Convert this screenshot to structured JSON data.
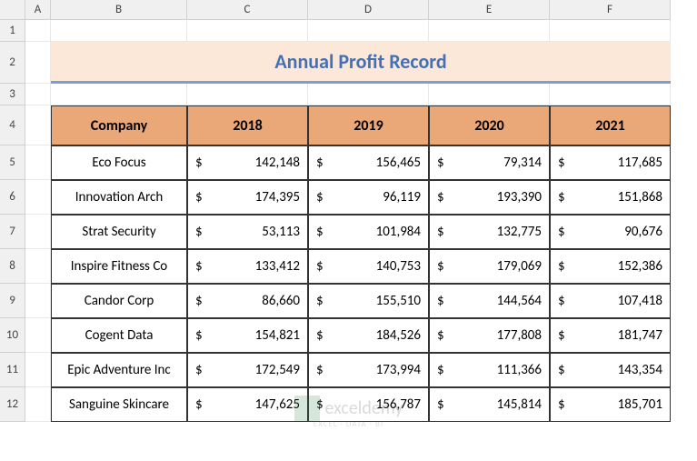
{
  "columns": [
    "A",
    "B",
    "C",
    "D",
    "E",
    "F"
  ],
  "rows": [
    "1",
    "2",
    "3",
    "4",
    "5",
    "6",
    "7",
    "8",
    "9",
    "10",
    "11",
    "12"
  ],
  "title": "Annual Profit Record",
  "headers": {
    "company": "Company",
    "y2018": "2018",
    "y2019": "2019",
    "y2020": "2020",
    "y2021": "2021"
  },
  "currency": "$",
  "data": [
    {
      "company": "Eco Focus",
      "y2018": "142,148",
      "y2019": "156,465",
      "y2020": "79,314",
      "y2021": "117,685"
    },
    {
      "company": "Innovation Arch",
      "y2018": "174,395",
      "y2019": "96,119",
      "y2020": "193,390",
      "y2021": "151,868"
    },
    {
      "company": "Strat Security",
      "y2018": "53,113",
      "y2019": "101,984",
      "y2020": "132,775",
      "y2021": "90,676"
    },
    {
      "company": "Inspire Fitness Co",
      "y2018": "133,412",
      "y2019": "140,753",
      "y2020": "179,069",
      "y2021": "152,386"
    },
    {
      "company": "Candor Corp",
      "y2018": "86,660",
      "y2019": "155,510",
      "y2020": "144,564",
      "y2021": "107,418"
    },
    {
      "company": "Cogent Data",
      "y2018": "154,821",
      "y2019": "184,526",
      "y2020": "177,808",
      "y2021": "181,747"
    },
    {
      "company": "Epic Adventure Inc",
      "y2018": "172,549",
      "y2019": "173,994",
      "y2020": "111,366",
      "y2021": "143,354"
    },
    {
      "company": "Sanguine Skincare",
      "y2018": "147,625",
      "y2019": "156,787",
      "y2020": "145,814",
      "y2021": "185,701"
    }
  ],
  "watermark": {
    "name": "exceldemy",
    "sub": "EXCEL · DATA · BI"
  }
}
